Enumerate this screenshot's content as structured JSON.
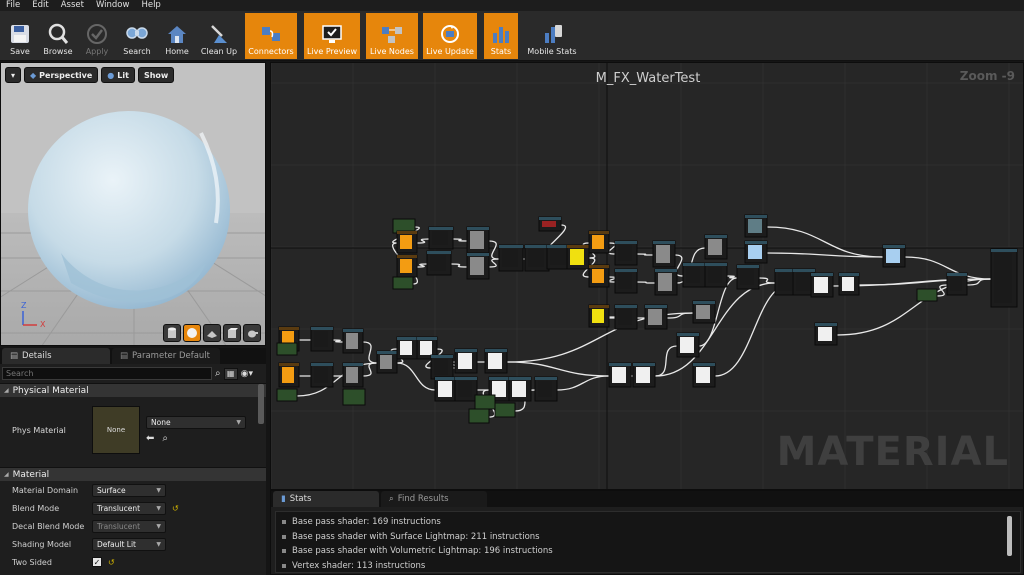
{
  "menu": [
    "File",
    "Edit",
    "Asset",
    "Window",
    "Help"
  ],
  "toolbar": {
    "buttons": [
      {
        "label": "Save",
        "icon": "save-icon",
        "state": "normal"
      },
      {
        "label": "Browse",
        "icon": "browse-icon",
        "state": "normal"
      },
      {
        "label": "Apply",
        "icon": "apply-icon",
        "state": "disabled"
      },
      {
        "label": "Search",
        "icon": "search-icon",
        "state": "normal"
      },
      {
        "label": "Home",
        "icon": "home-icon",
        "state": "normal"
      },
      {
        "label": "Clean Up",
        "icon": "cleanup-icon",
        "state": "normal"
      },
      {
        "label": "Connectors",
        "icon": "connectors-icon",
        "state": "active"
      },
      {
        "label": "Live Preview",
        "icon": "live-preview-icon",
        "state": "active"
      },
      {
        "label": "Live Nodes",
        "icon": "live-nodes-icon",
        "state": "active"
      },
      {
        "label": "Live Update",
        "icon": "live-update-icon",
        "state": "active"
      },
      {
        "label": "Stats",
        "icon": "stats-icon",
        "state": "active"
      },
      {
        "label": "Mobile Stats",
        "icon": "mobile-stats-icon",
        "state": "normal"
      }
    ]
  },
  "viewport": {
    "perspective_label": "Perspective",
    "lit_label": "Lit",
    "show_label": "Show",
    "axis_z": "Z",
    "axis_x": "X",
    "preview_shapes": [
      "cylinder-icon",
      "sphere-icon",
      "plane-icon",
      "cube-icon",
      "teapot-icon"
    ],
    "selected_shape": "sphere-icon"
  },
  "details": {
    "tabs": [
      {
        "label": "Details",
        "active": true
      },
      {
        "label": "Parameter Default",
        "active": false
      }
    ],
    "search_placeholder": "Search",
    "physical_material": {
      "header": "Physical Material",
      "prop_label": "Phys Material",
      "thumb_text": "None",
      "value": "None"
    },
    "material": {
      "header": "Material",
      "props": [
        {
          "label": "Material Domain",
          "value": "Surface",
          "enabled": true,
          "reset": false
        },
        {
          "label": "Blend Mode",
          "value": "Translucent",
          "enabled": true,
          "reset": true
        },
        {
          "label": "Decal Blend Mode",
          "value": "Translucent",
          "enabled": false,
          "reset": false
        },
        {
          "label": "Shading Model",
          "value": "Default Lit",
          "enabled": true,
          "reset": false
        }
      ],
      "two_sided_label": "Two Sided",
      "two_sided": true
    }
  },
  "graph": {
    "title": "M_FX_WaterTest",
    "zoom": "Zoom -9",
    "watermark": "MATERIAL",
    "colors": {
      "accent": "#e6860c",
      "node_header": "#2d4f2a",
      "wire": "#e8e8e8",
      "param": "#f39c12"
    }
  },
  "stats": {
    "tabs": [
      {
        "label": "Stats",
        "active": true
      },
      {
        "label": "Find Results",
        "active": false
      }
    ],
    "lines": [
      "Base pass shader: 169 instructions",
      "Base pass shader with Surface Lightmap: 211 instructions",
      "Base pass shader with Volumetric Lightmap: 196 instructions",
      "Vertex shader: 113 instructions"
    ]
  }
}
